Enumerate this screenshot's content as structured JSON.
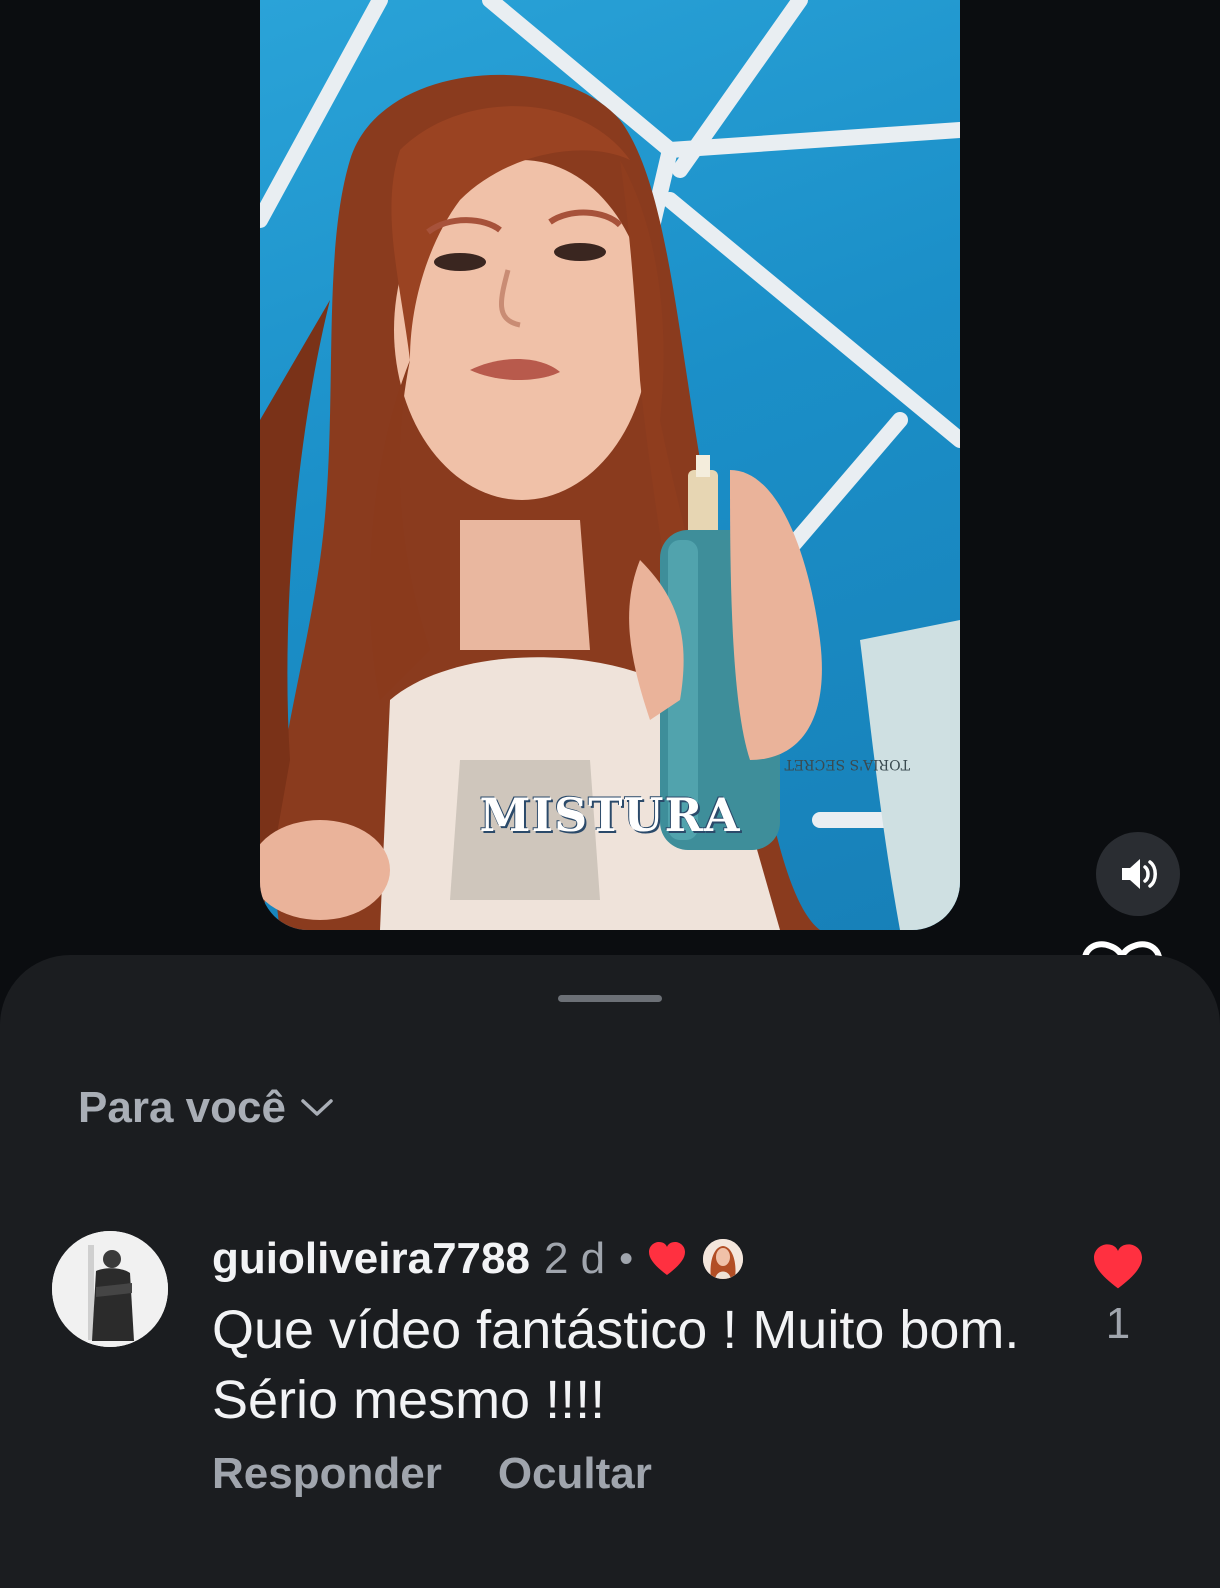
{
  "video": {
    "caption": "MISTURA",
    "product_label": "TORIA'S SECRET"
  },
  "controls": {
    "sound_icon": "speaker-on-icon",
    "like_icon": "heart-outline-icon"
  },
  "sheet": {
    "filter_label": "Para você",
    "filter_icon": "chevron-down-icon"
  },
  "comment": {
    "username": "guioliveira7788",
    "time": "2 d",
    "separator": "•",
    "text": "Que vídeo fantástico ! Muito bom. Sério mesmo !!!!",
    "reply_label": "Responder",
    "hide_label": "Ocultar",
    "like_count": "1",
    "creator_liked_icon": "heart-filled-icon",
    "like_color": "#ff3040"
  }
}
